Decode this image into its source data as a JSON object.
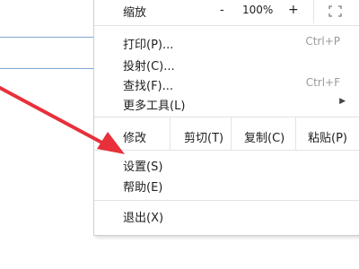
{
  "menu": {
    "zoom": {
      "label": "缩放",
      "minus": "-",
      "value": "100%",
      "plus": "+"
    },
    "print": {
      "label": "打印(P)...",
      "shortcut": "Ctrl+P"
    },
    "cast": {
      "label": "投射(C)..."
    },
    "find": {
      "label": "查找(F)...",
      "shortcut": "Ctrl+F"
    },
    "more_tools": {
      "label": "更多工具(L)"
    },
    "edit": {
      "label": "修改",
      "cut": "剪切(T)",
      "copy": "复制(C)",
      "paste": "粘贴(P)"
    },
    "settings": {
      "label": "设置(S)"
    },
    "help": {
      "label": "帮助(E)"
    },
    "exit": {
      "label": "退出(X)"
    }
  },
  "annotation": {
    "arrow_color": "#e8303a"
  },
  "icons": {
    "fullscreen": "fullscreen-icon",
    "submenu": "triangle-right-icon"
  }
}
